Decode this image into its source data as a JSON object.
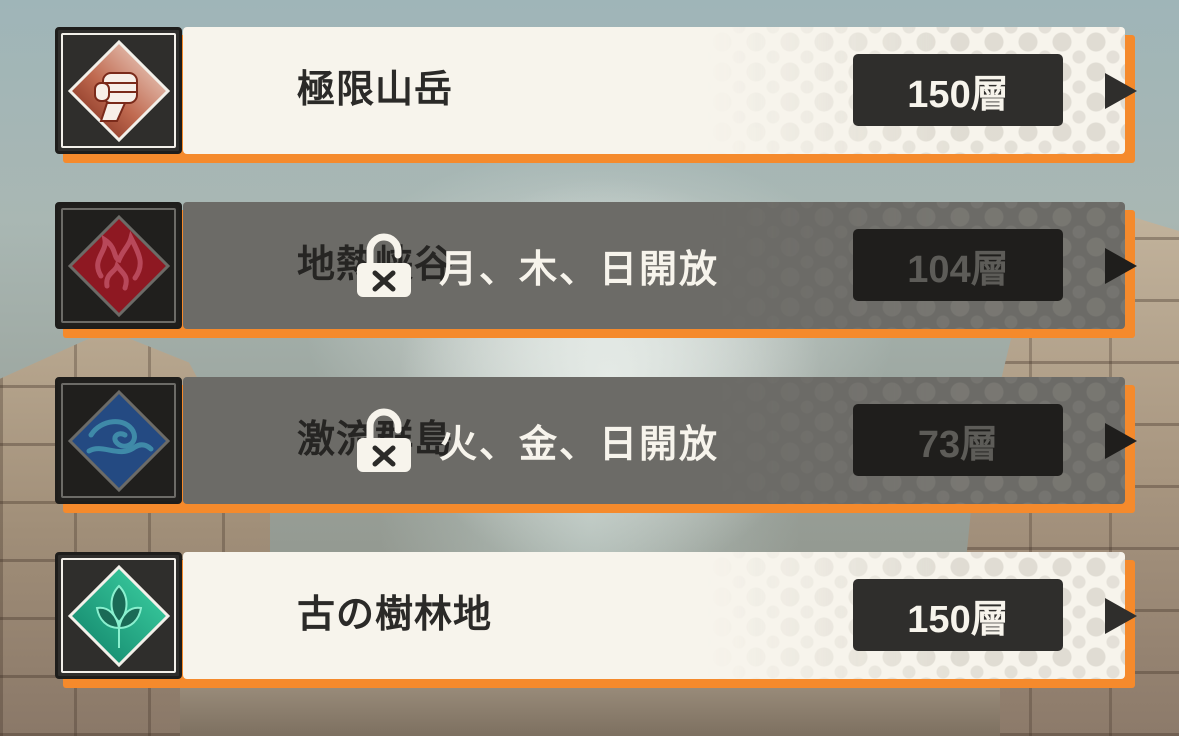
{
  "accent_color": "#f58a2c",
  "domains": [
    {
      "name": "極限山岳",
      "floors": "150層",
      "locked": false,
      "icon": "fist-icon",
      "icon_color": "#8a2a1a"
    },
    {
      "name": "地熱峡谷",
      "floors": "104層",
      "locked": true,
      "lock_text": "月、木、日開放",
      "icon": "flame-icon",
      "icon_color": "#9a1a24"
    },
    {
      "name": "激流群島",
      "floors": "73層",
      "locked": true,
      "lock_text": "火、金、日開放",
      "icon": "wave-icon",
      "icon_color": "#2a4e86"
    },
    {
      "name": "古の樹林地",
      "floors": "150層",
      "locked": false,
      "icon": "leaf-icon",
      "icon_color": "#1f9a78"
    }
  ]
}
